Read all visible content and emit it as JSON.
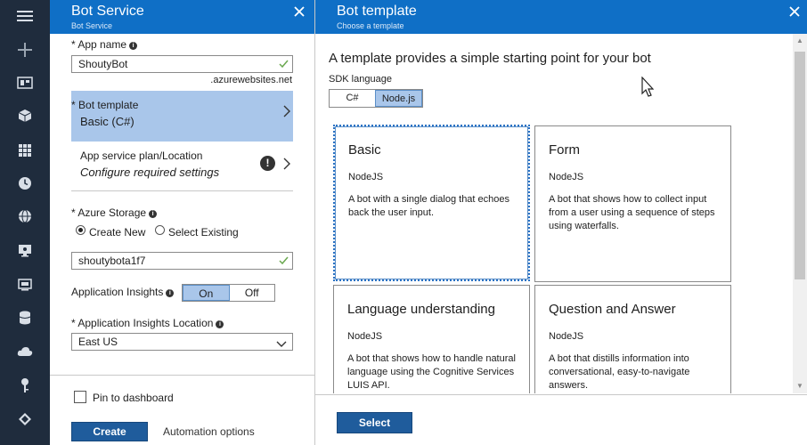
{
  "nav": {
    "icons": [
      "menu-icon",
      "plus-icon",
      "dashboard-icon",
      "cube-icon",
      "grid-icon",
      "clock-icon",
      "globe-icon",
      "monitor-icon",
      "screen-icon",
      "database-icon",
      "cloud-icon",
      "key-icon",
      "diamond-icon"
    ]
  },
  "botService": {
    "title": "Bot Service",
    "subtitle": "Bot Service",
    "appName": {
      "label": "App name",
      "required": "*",
      "value": "ShoutyBot",
      "suffix": ".azurewebsites.net"
    },
    "botTemplate": {
      "label": "Bot template",
      "value": "Basic (C#)"
    },
    "appServicePlan": {
      "label": "App service plan/Location",
      "value": "Configure required settings"
    },
    "azureStorage": {
      "label": "Azure Storage",
      "createNew": "Create New",
      "selectExisting": "Select Existing",
      "value": "shoutybota1f7"
    },
    "appInsights": {
      "label": "Application Insights",
      "on": "On",
      "off": "Off"
    },
    "appInsightsLocation": {
      "label": "Application Insights Location",
      "value": "East US"
    },
    "pinToDashboard": "Pin to dashboard",
    "createButton": "Create",
    "automationOptions": "Automation options"
  },
  "botTemplate": {
    "title": "Bot template",
    "subtitle": "Choose a template",
    "heading": "A template provides a simple starting point for your bot",
    "sdkLabel": "SDK language",
    "sdkOptions": [
      "C#",
      "Node.js"
    ],
    "selectButton": "Select",
    "cards": [
      {
        "title": "Basic",
        "sdk": "NodeJS",
        "description": "A bot with a single dialog that echoes back the user input."
      },
      {
        "title": "Form",
        "sdk": "NodeJS",
        "description": "A bot that shows how to collect input from a user using a sequence of steps using waterfalls."
      },
      {
        "title": "Language understanding",
        "sdk": "NodeJS",
        "description": "A bot that shows how to handle natural language using the Cognitive Services LUIS API."
      },
      {
        "title": "Question and Answer",
        "sdk": "NodeJS",
        "description": "A bot that distills information into conversational, easy-to-navigate answers."
      }
    ]
  },
  "colors": {
    "accent": "#0f6fc6",
    "nav": "#1f2c3d",
    "selection": "#a9c6ea",
    "primaryButton": "#1f5c9c"
  }
}
